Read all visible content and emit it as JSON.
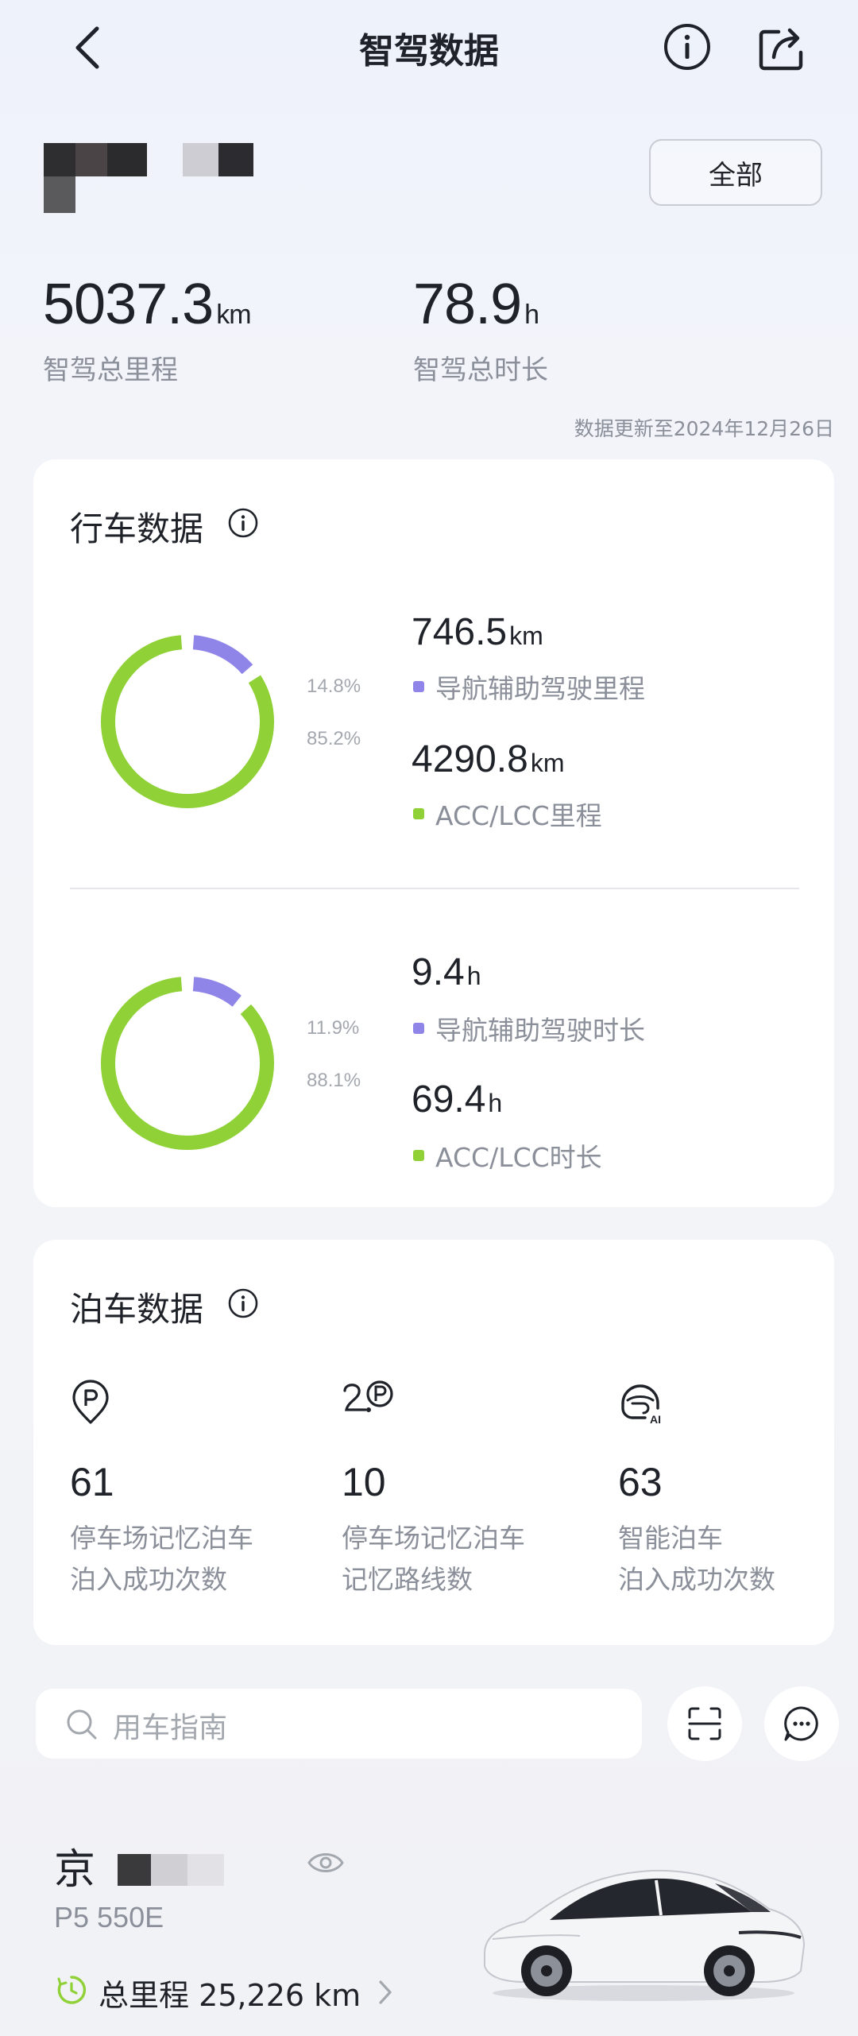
{
  "header": {
    "title": "智驾数据",
    "filter_label": "全部"
  },
  "summary": {
    "total_distance": {
      "value": "5037.3",
      "unit": "km",
      "label": "智驾总里程"
    },
    "total_duration": {
      "value": "78.9",
      "unit": "h",
      "label": "智驾总时长"
    },
    "update_note": "数据更新至2024年12月26日"
  },
  "driving": {
    "title": "行车数据",
    "distance": {
      "items": [
        {
          "value": "746.5",
          "unit": "km",
          "label": "导航辅助驾驶里程",
          "percent_label": "14.8%",
          "share": 0.148,
          "color": "#8f84e8"
        },
        {
          "value": "4290.8",
          "unit": "km",
          "label": "ACC/LCC里程",
          "percent_label": "85.2%",
          "share": 0.852,
          "color": "#8fd136"
        }
      ]
    },
    "duration": {
      "items": [
        {
          "value": "9.4",
          "unit": "h",
          "label": "导航辅助驾驶时长",
          "percent_label": "11.9%",
          "share": 0.119,
          "color": "#8f84e8"
        },
        {
          "value": "69.4",
          "unit": "h",
          "label": "ACC/LCC时长",
          "percent_label": "88.1%",
          "share": 0.881,
          "color": "#8fd136"
        }
      ]
    }
  },
  "parking": {
    "title": "泊车数据",
    "items": [
      {
        "icon": "parking-pin-icon",
        "value": "61",
        "line1": "停车场记忆泊车",
        "line2": "泊入成功次数"
      },
      {
        "icon": "route-parking-icon",
        "value": "10",
        "line1": "停车场记忆泊车",
        "line2": "记忆路线数"
      },
      {
        "icon": "ai-parking-icon",
        "value": "63",
        "line1": "智能泊车",
        "line2": "泊入成功次数"
      }
    ]
  },
  "search": {
    "placeholder": "用车指南"
  },
  "vehicle": {
    "plate_prefix": "京",
    "model": "P5 550E",
    "odometer_label": "总里程 25,226 km"
  },
  "colors": {
    "purple": "#8f84e8",
    "green": "#8fd136",
    "text_secondary": "#8a8f99"
  }
}
